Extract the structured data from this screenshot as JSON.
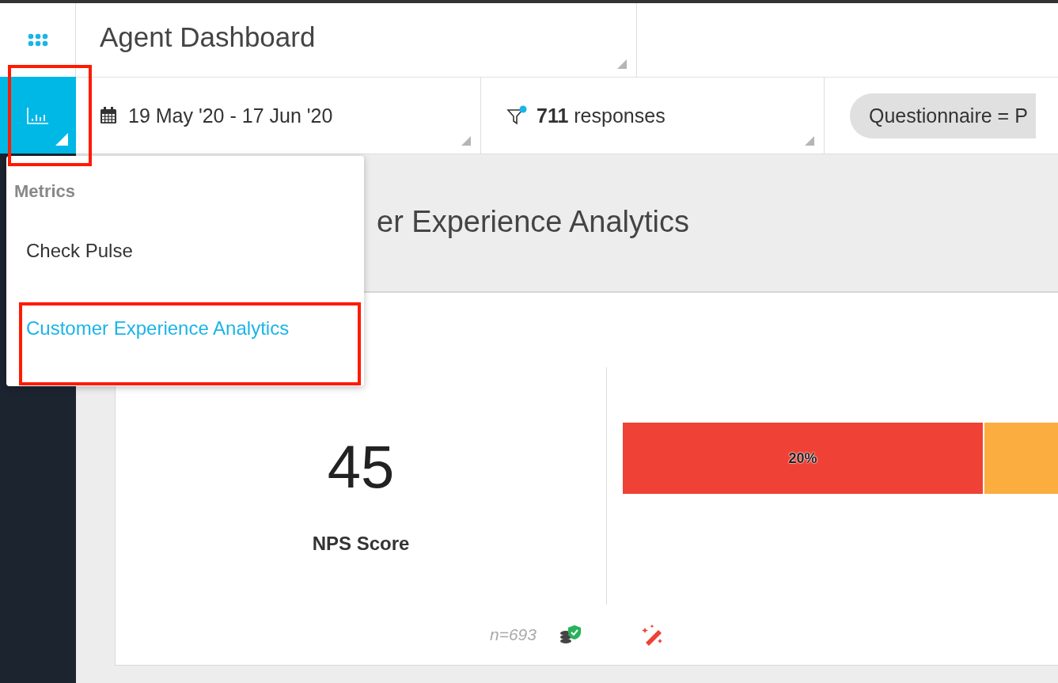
{
  "header": {
    "title": "Agent Dashboard"
  },
  "sidebar": {
    "metrics_button": {
      "highlighted": true
    }
  },
  "filters": {
    "date_range": "19 May '20 - 17 Jun '20",
    "response_count": "711",
    "response_label": "responses",
    "pill": "Questionnaire = P"
  },
  "menu": {
    "heading": "Metrics",
    "items": [
      {
        "label": "Check Pulse",
        "selected": false,
        "highlighted": false
      },
      {
        "label": "Customer Experience Analytics",
        "selected": true,
        "highlighted": true
      }
    ]
  },
  "section": {
    "title": "er Experience Analytics"
  },
  "card": {
    "score": "45",
    "score_label": "NPS Score",
    "sample": "n=693",
    "nps_bar": {
      "segments": [
        {
          "label": "20%",
          "color": "#ef4136",
          "level": 0.83
        },
        {
          "color": "#fbad3f",
          "level": 0.17
        }
      ]
    }
  }
}
